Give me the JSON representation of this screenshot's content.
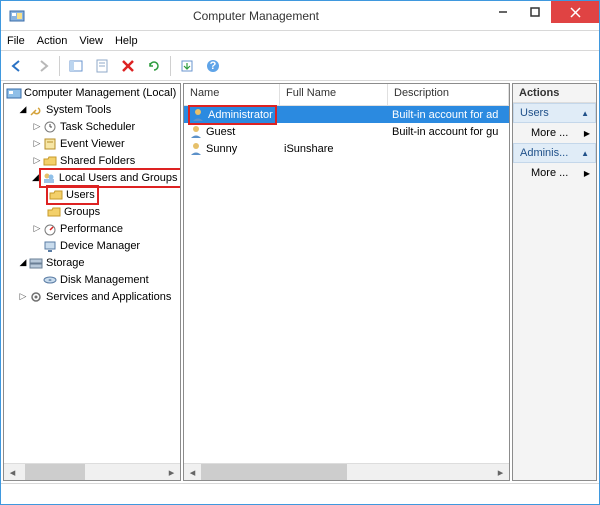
{
  "window": {
    "title": "Computer Management"
  },
  "menu": {
    "file": "File",
    "action": "Action",
    "view": "View",
    "help": "Help"
  },
  "tree": {
    "root": "Computer Management (Local)",
    "system_tools": "System Tools",
    "task_scheduler": "Task Scheduler",
    "event_viewer": "Event Viewer",
    "shared_folders": "Shared Folders",
    "local_users_groups": "Local Users and Groups",
    "users": "Users",
    "groups": "Groups",
    "performance": "Performance",
    "device_manager": "Device Manager",
    "storage": "Storage",
    "disk_management": "Disk Management",
    "services_apps": "Services and Applications"
  },
  "list": {
    "headers": {
      "name": "Name",
      "full_name": "Full Name",
      "description": "Description"
    },
    "rows": [
      {
        "name": "Administrator",
        "full_name": "",
        "description": "Built-in account for ad"
      },
      {
        "name": "Guest",
        "full_name": "",
        "description": "Built-in account for gu"
      },
      {
        "name": "Sunny",
        "full_name": "iSunshare",
        "description": ""
      }
    ]
  },
  "actions": {
    "title": "Actions",
    "section1": "Users",
    "more1": "More ...",
    "section2": "Adminis...",
    "more2": "More ..."
  }
}
